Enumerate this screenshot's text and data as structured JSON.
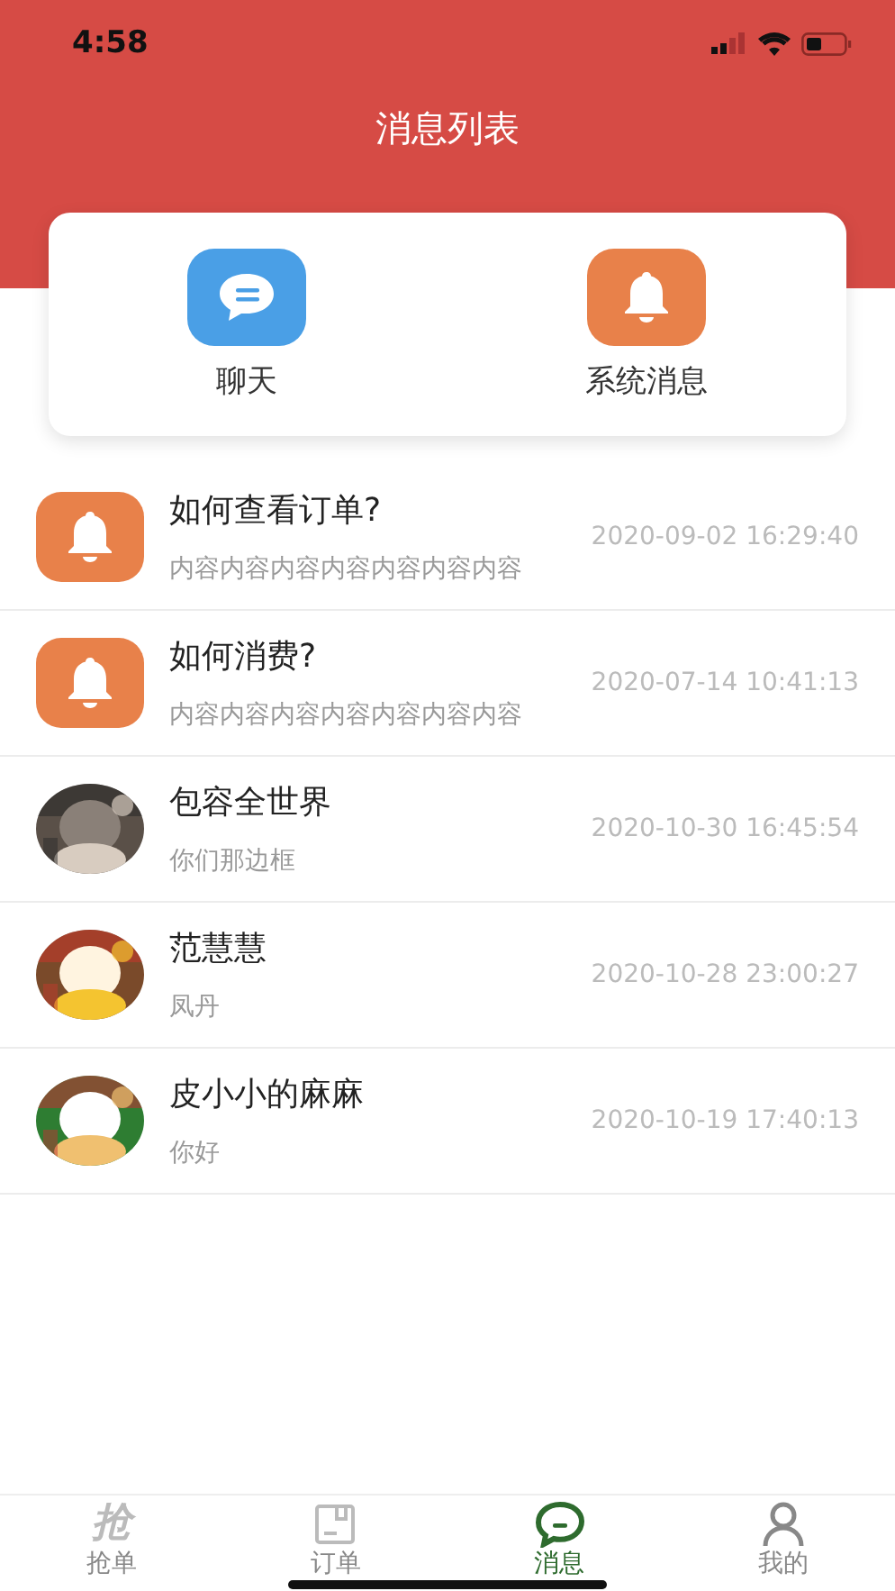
{
  "status_bar": {
    "time": "4:58"
  },
  "header": {
    "title": "消息列表"
  },
  "shortcuts": [
    {
      "kind": "chat",
      "label": "聊天"
    },
    {
      "kind": "system",
      "label": "系统消息"
    }
  ],
  "messages": [
    {
      "kind": "system",
      "title": "如何查看订单?",
      "preview": "内容内容内容内容内容内容内容",
      "time": "2020-09-02 16:29:40"
    },
    {
      "kind": "system",
      "title": "如何消费?",
      "preview": "内容内容内容内容内容内容内容",
      "time": "2020-07-14 10:41:13"
    },
    {
      "kind": "picture",
      "title": "包容全世界",
      "preview": "你们那边框",
      "time": "2020-10-30 16:45:54"
    },
    {
      "kind": "picture",
      "title": "范慧慧",
      "preview": "凤丹",
      "time": "2020-10-28 23:00:27"
    },
    {
      "kind": "picture",
      "title": "皮小小的麻麻",
      "preview": "你好",
      "time": "2020-10-19 17:40:13"
    }
  ],
  "tab_bar": [
    {
      "kind": "glyph",
      "glyph": "抢",
      "label": "抢单",
      "selected": false
    },
    {
      "kind": "box",
      "label": "订单",
      "selected": false
    },
    {
      "kind": "bubble",
      "label": "消息",
      "selected": true
    },
    {
      "kind": "person",
      "label": "我的",
      "selected": false
    }
  ]
}
